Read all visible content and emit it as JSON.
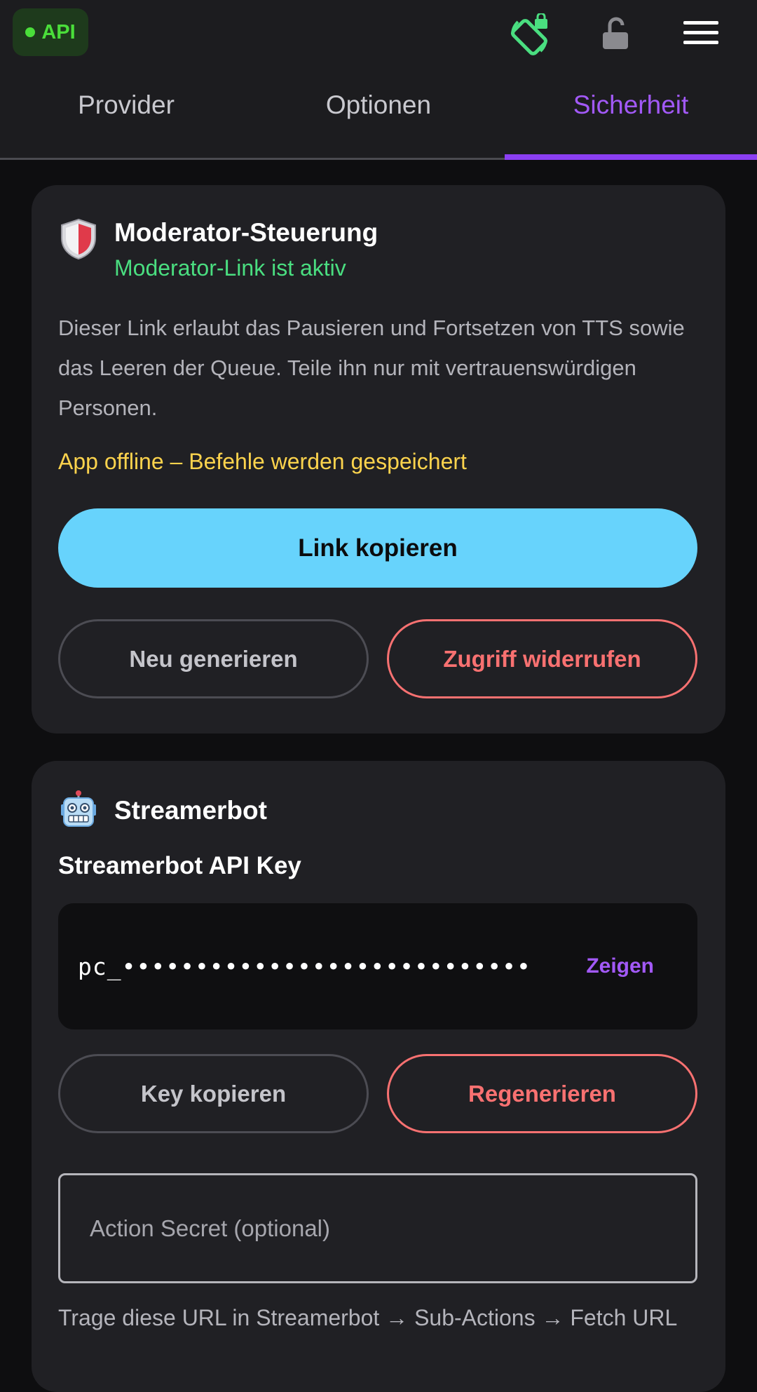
{
  "topbar": {
    "api_badge": "API",
    "status_color": "#4ade3a",
    "icons": [
      "screen-rotation-lock-icon",
      "unlocked-padlock-icon",
      "hamburger-menu-icon"
    ]
  },
  "tabs": [
    {
      "label": "Provider",
      "active": false
    },
    {
      "label": "Optionen",
      "active": false
    },
    {
      "label": "Sicherheit",
      "active": true
    }
  ],
  "accent_color": "#8b3ff2",
  "moderator": {
    "icon": "shield-icon",
    "title": "Moderator-Steuerung",
    "status": "Moderator-Link ist aktiv",
    "description": "Dieser Link erlaubt das Pausieren und Fortsetzen von TTS sowie das Leeren der Queue. Teile ihn nur mit vertrauenswürdigen Personen.",
    "warning": "App offline – Befehle werden gespeichert",
    "copy_button": "Link kopieren",
    "regenerate_button": "Neu generieren",
    "revoke_button": "Zugriff widerrufen"
  },
  "streamerbot": {
    "icon": "robot-icon",
    "title": "Streamerbot",
    "key_label": "Streamerbot API Key",
    "key_value": "pc_••••••••••••••••••••••••••••",
    "show_button": "Zeigen",
    "copy_key_button": "Key kopieren",
    "regenerate_button": "Regenerieren",
    "secret_placeholder": "Action Secret (optional)",
    "hint": "Trage diese URL in Streamerbot → Sub-Actions → Fetch URL"
  }
}
